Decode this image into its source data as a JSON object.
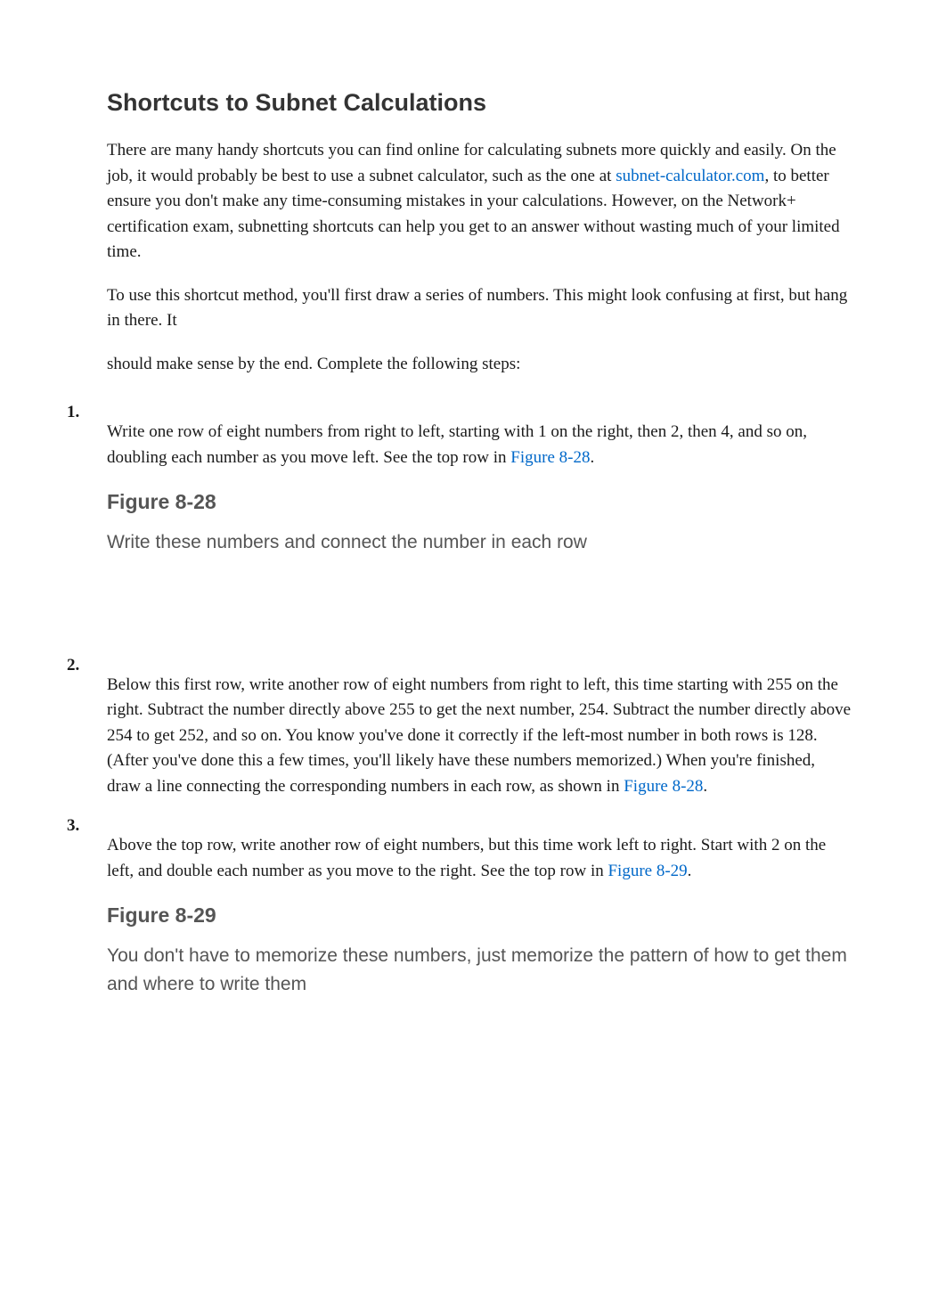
{
  "heading": "Shortcuts to Subnet Calculations",
  "intro": {
    "p1_before_link": "There are many handy shortcuts you can find online for calculating subnets more quickly and easily. On the job, it would probably be best to use a subnet calculator, such as the one at ",
    "link_text": "subnet-calculator.com",
    "p1_after_link": ", to better ensure you don't make any time-consuming mistakes in your calculations. However, on the Network+ certification exam, subnetting shortcuts can help you get to an answer without wasting much of your limited time.",
    "p2": "To use this shortcut method, you'll first draw a series of numbers. This might look confusing at first, but hang in there. It",
    "p3": " should make sense by the end. Complete the following steps:"
  },
  "steps": {
    "s1": {
      "num": "1.",
      "text_before_ref": "Write one row of eight numbers from right to left, starting with 1 on the right, then 2, then 4, and so on, doubling each number as you move left. See the top row in ",
      "ref": "Figure 8-28",
      "text_after_ref": ".",
      "figure_label": "Figure 8-28",
      "figure_caption": "Write these numbers and connect the number in each row"
    },
    "s2": {
      "num": "2.",
      "text_before_ref": "Below this first row, write another row of eight numbers from right to left, this time starting with 255 on the right. Subtract the number directly above 255 to get the next number, 254. Subtract the number directly above 254 to get 252, and so on. You know you've done it correctly if the left-most number in both rows is 128. (After you've done this a few times, you'll likely have these numbers memorized.) When you're finished, draw a line connecting the corresponding numbers in each row, as shown in ",
      "ref": "Figure 8-28",
      "text_after_ref": "."
    },
    "s3": {
      "num": "3.",
      "text_before_ref": "Above the top row, write another row of eight numbers, but this time work left to right. Start with 2 on the left, and double each number as you move to the right. See the top row in ",
      "ref": "Figure 8-29",
      "text_after_ref": ".",
      "figure_label": "Figure 8-29",
      "figure_caption": "You don't have to memorize these numbers, just memorize the pattern of how to get them and where to write them"
    }
  }
}
